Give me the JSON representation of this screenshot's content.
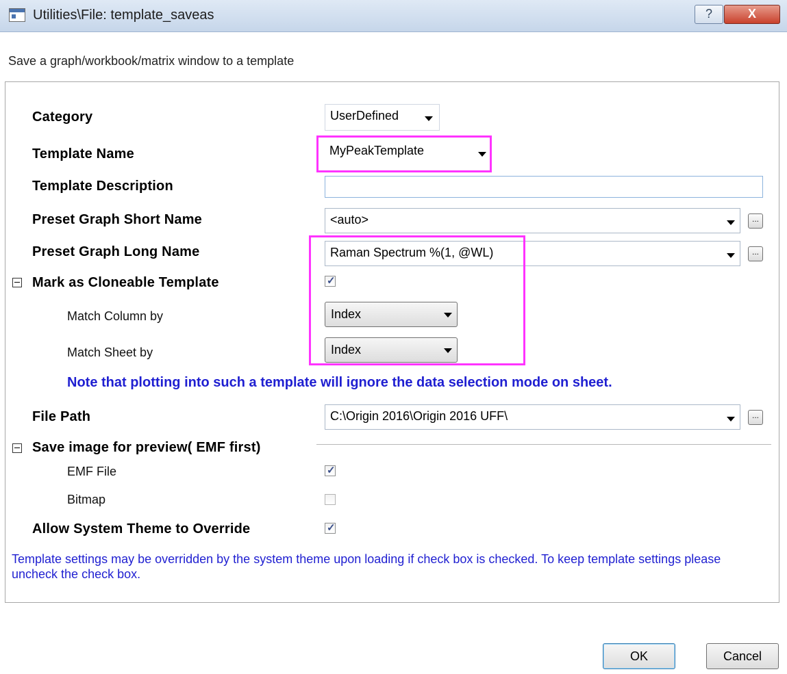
{
  "window": {
    "title": "Utilities\\File: template_saveas",
    "help_label": "?",
    "close_label": "X"
  },
  "subtitle": "Save a graph/workbook/matrix window to a template",
  "fields": {
    "category": {
      "label": "Category",
      "value": "UserDefined"
    },
    "template_name": {
      "label": "Template Name",
      "value": "MyPeakTemplate"
    },
    "template_description": {
      "label": "Template Description",
      "value": ""
    },
    "preset_short_name": {
      "label": "Preset Graph Short Name",
      "value": "<auto>",
      "browse_label": "..."
    },
    "preset_long_name": {
      "label": "Preset Graph Long Name",
      "value": "Raman Spectrum  %(1, @WL)",
      "browse_label": "..."
    },
    "cloneable": {
      "label": "Mark as Cloneable Template",
      "checked": true,
      "match_column": {
        "label": "Match Column by",
        "value": "Index"
      },
      "match_sheet": {
        "label": "Match Sheet by",
        "value": "Index"
      }
    },
    "note": "Note that plotting into such a template will ignore the data selection mode on sheet.",
    "file_path": {
      "label": "File Path",
      "value": "C:\\Origin 2016\\Origin 2016 UFF\\",
      "browse_label": "..."
    },
    "save_image": {
      "label": "Save image for preview( EMF first)",
      "emf": {
        "label": "EMF File",
        "checked": true
      },
      "bitmap": {
        "label": "Bitmap",
        "checked": false
      }
    },
    "allow_theme": {
      "label": "Allow System Theme to Override",
      "checked": true
    },
    "theme_note": "Template settings may be overridden by the system theme upon loading if check box is checked. To keep template settings please uncheck the check box."
  },
  "buttons": {
    "ok": "OK",
    "cancel": "Cancel"
  },
  "colors": {
    "highlight": "#ff33ff",
    "note_text": "#1f1fd1"
  }
}
